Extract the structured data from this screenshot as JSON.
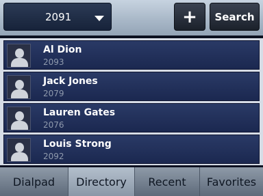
{
  "header": {
    "line_value": "2091",
    "add_label": "+",
    "search_label": "Search"
  },
  "contacts": [
    {
      "name": "Al Dion",
      "number": "2093"
    },
    {
      "name": "Jack Jones",
      "number": "2079"
    },
    {
      "name": "Lauren Gates",
      "number": "2076"
    },
    {
      "name": "Louis Strong",
      "number": "2092"
    }
  ],
  "tabs": [
    {
      "label": "Dialpad"
    },
    {
      "label": "Directory"
    },
    {
      "label": "Recent"
    },
    {
      "label": "Favorites"
    }
  ],
  "active_tab": "Directory"
}
